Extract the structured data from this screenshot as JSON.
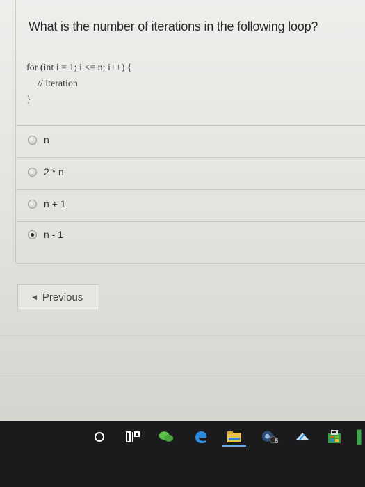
{
  "question": {
    "title": "What is the number of iterations in the following loop?",
    "code_lines": [
      "for (int i = 1; i <= n; i++) {",
      "// iteration",
      "}"
    ]
  },
  "options": [
    {
      "label": "n",
      "selected": false
    },
    {
      "label": "2 * n",
      "selected": false
    },
    {
      "label": "n + 1",
      "selected": false
    },
    {
      "label": "n - 1",
      "selected": true
    }
  ],
  "navigation": {
    "previous_label": "Previous"
  },
  "taskbar": {
    "icons": [
      "cortana-icon",
      "task-view-icon",
      "wechat-icon",
      "edge-icon",
      "file-explorer-icon",
      "steam-icon",
      "media-player-icon",
      "store-icon"
    ],
    "steam_badge": "5"
  },
  "colors": {
    "taskbar": "#1b1b1d",
    "page": "#e8e7e3",
    "edge_blue": "#2b8ae0",
    "wechat_green": "#5cc24a",
    "store_green": "#3a9b3a"
  }
}
